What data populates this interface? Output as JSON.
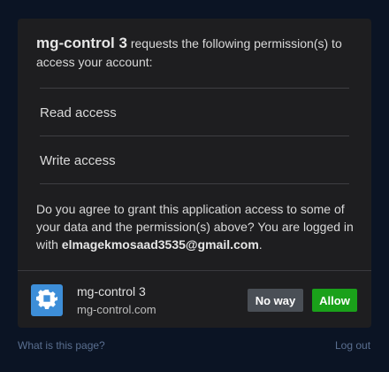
{
  "header": {
    "app_name": "mg-control 3",
    "request_text": " requests the following permission(s) to access your account:"
  },
  "permissions": [
    {
      "label": "Read access"
    },
    {
      "label": "Write access"
    }
  ],
  "consent": {
    "text": "Do you agree to grant this application access to some of your data and the permission(s) above? You are logged in with ",
    "email": "elmagekmosaad3535@gmail.com",
    "period": "."
  },
  "app": {
    "name": "mg-control 3",
    "domain": "mg-control.com",
    "icon": "gear-icon",
    "icon_color": "#3d8ed8"
  },
  "buttons": {
    "deny_label": "No way",
    "allow_label": "Allow",
    "allow_color": "#1aa11a"
  },
  "links": {
    "help": "What is this page?",
    "logout": "Log out"
  }
}
